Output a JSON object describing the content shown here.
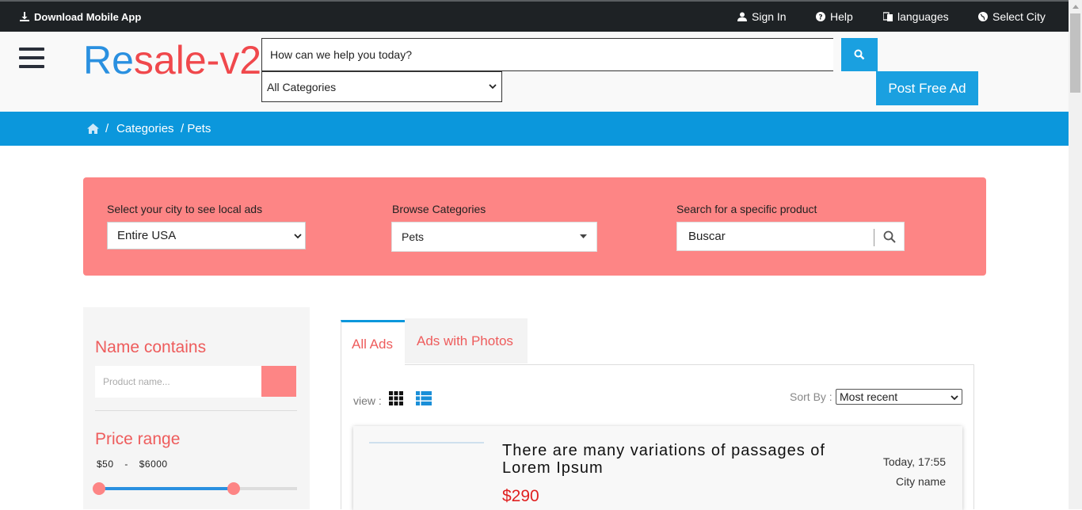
{
  "topbar": {
    "download": "Download Mobile App",
    "sign_in": "Sign In",
    "help": "Help",
    "languages": "languages",
    "select_city": "Select City"
  },
  "header": {
    "logo_part1": "Re",
    "logo_part2": "sale-v2",
    "search_placeholder": "How can we help you today?",
    "category_select": "All Categories",
    "post_ad": "Post Free Ad"
  },
  "breadcrumb": {
    "sep1": "/",
    "categories": "Categories",
    "current": "/ Pets"
  },
  "filter": {
    "city_label": "Select your city to see local ads",
    "city_value": "Entire USA",
    "category_label": "Browse Categories",
    "category_value": "Pets",
    "search_label": "Search for a specific product",
    "search_value": "Buscar"
  },
  "sidebar": {
    "name_title": "Name contains",
    "name_placeholder": "Product name...",
    "price_title": "Price range",
    "price_min": "$50",
    "price_dash": "-",
    "price_max": "$6000",
    "slider_low_fraction": 0.0,
    "slider_high_fraction": 0.68
  },
  "main": {
    "tabs": [
      "All Ads",
      "Ads with Photos"
    ],
    "view_label": "view :",
    "sort_label": "Sort By :",
    "sort_value": "Most recent",
    "listing": {
      "title": "There are many variations of passages of Lorem Ipsum",
      "price": "$290",
      "time": "Today, 17:55",
      "city": "City name"
    }
  },
  "colors": {
    "accent_blue": "#0b97dc",
    "coral": "#fd8585",
    "price_red": "#e02020",
    "topbar": "#1e2225"
  }
}
